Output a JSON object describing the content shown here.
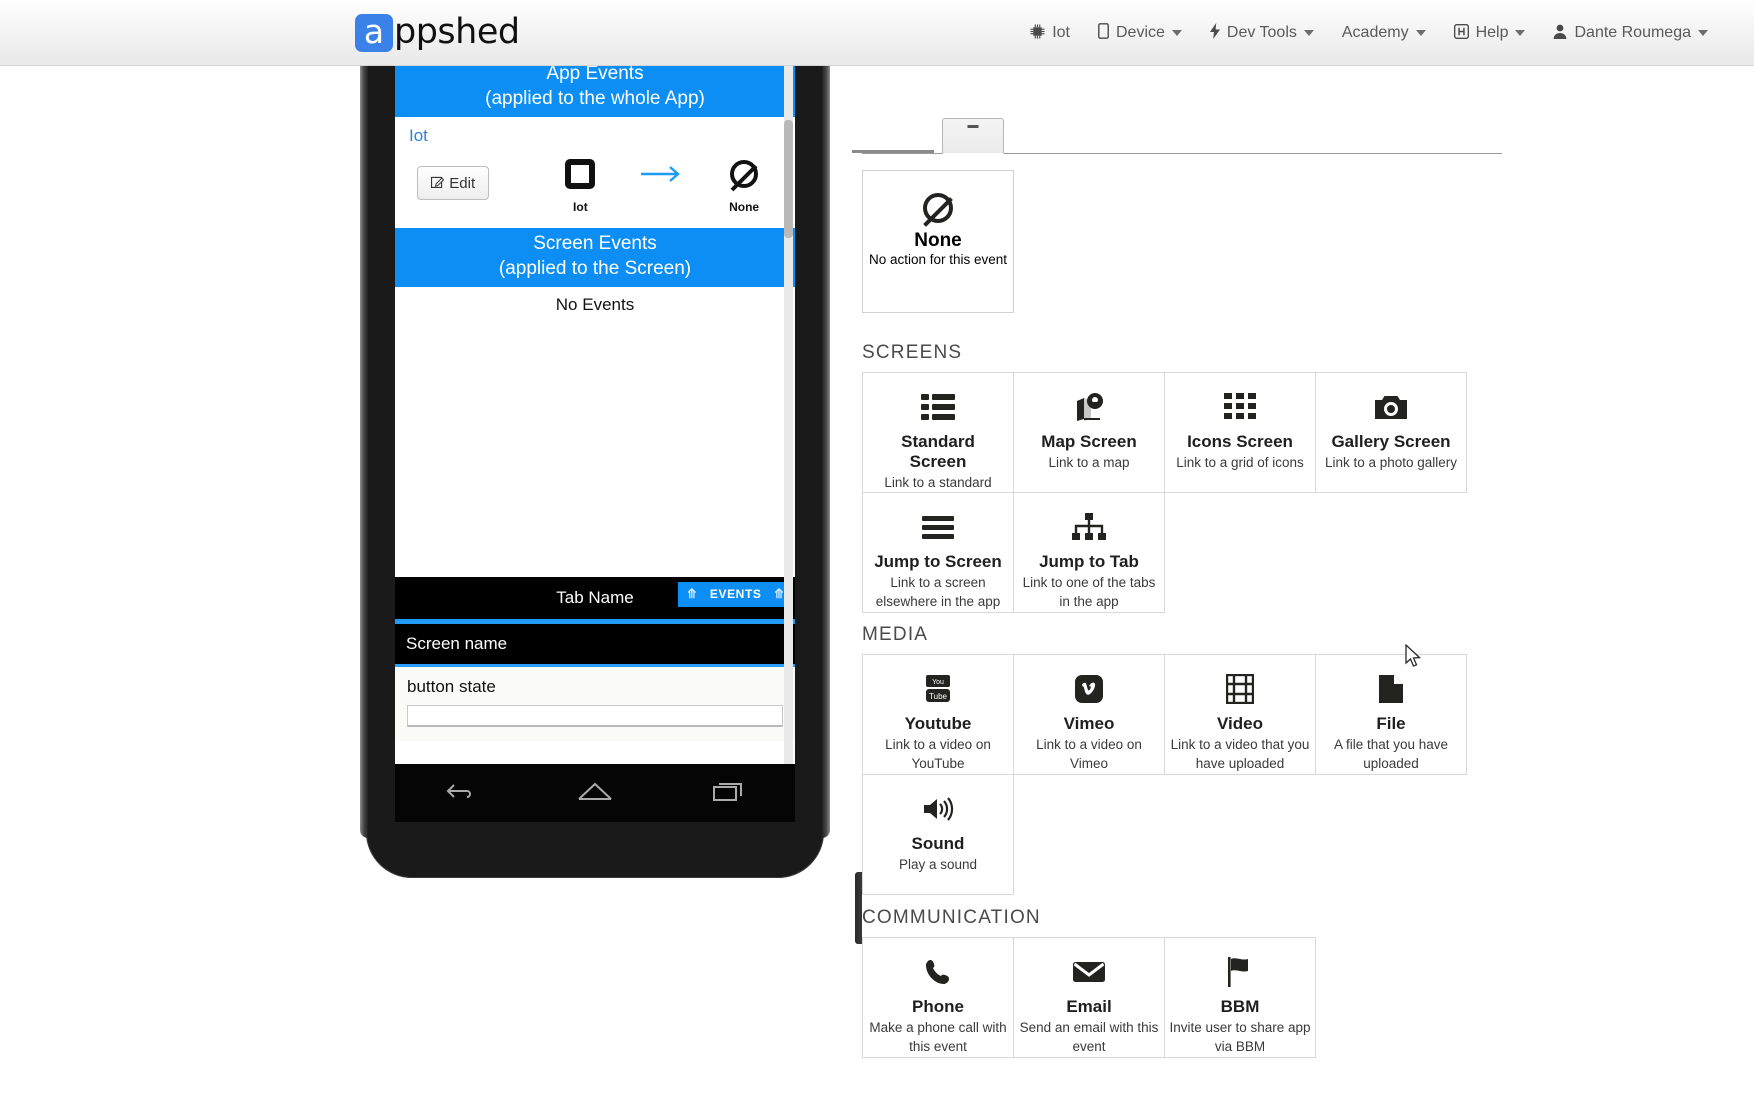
{
  "header": {
    "brand_letter": "a",
    "brand_text": "ppshed",
    "nav": [
      {
        "label": "Iot",
        "icon": "chip-icon",
        "caret": false
      },
      {
        "label": "Device",
        "icon": "mobile-icon",
        "caret": true
      },
      {
        "label": "Dev Tools",
        "icon": "bolt-icon",
        "caret": true
      },
      {
        "label": "Academy",
        "icon": "none",
        "caret": true
      },
      {
        "label": "Help",
        "icon": "help-square-icon",
        "caret": true
      },
      {
        "label": "Dante Roumega",
        "icon": "user-icon",
        "caret": true
      }
    ]
  },
  "phone": {
    "app_events": {
      "title": "App Events",
      "subtitle": "(applied to the whole App)"
    },
    "event_name": "Iot",
    "edit_button": "Edit",
    "trigger_caption": "Iot",
    "action_caption": "None",
    "screen_events": {
      "title": "Screen Events",
      "subtitle": "(applied to the Screen)"
    },
    "no_events": "No Events",
    "tab_name": "Tab Name",
    "events_button": "EVENTS",
    "screen_name": "Screen name",
    "form_label": "button state",
    "form_value": ""
  },
  "actions_panel": {
    "selected_action": {
      "title": "None",
      "desc": "No action for this event",
      "icon": "ban-icon"
    },
    "groups": [
      {
        "title": "SCREENS",
        "cards": [
          {
            "title": "Standard Screen",
            "desc": "Link to a standard",
            "icon": "list-icon"
          },
          {
            "title": "Map Screen",
            "desc": "Link to a map",
            "icon": "map-marker-icon"
          },
          {
            "title": "Icons Screen",
            "desc": "Link to a grid of icons",
            "icon": "grid-icon"
          },
          {
            "title": "Gallery Screen",
            "desc": "Link to a photo gallery",
            "icon": "camera-icon"
          },
          {
            "title": "Jump to Screen",
            "desc": "Link to a screen elsewhere in the app",
            "icon": "bars-icon"
          },
          {
            "title": "Jump to Tab",
            "desc": "Link to one of the tabs in the app",
            "icon": "sitemap-icon"
          }
        ]
      },
      {
        "title": "MEDIA",
        "cards": [
          {
            "title": "Youtube",
            "desc": "Link to a video on YouTube",
            "icon": "youtube-icon"
          },
          {
            "title": "Vimeo",
            "desc": "Link to a video on Vimeo",
            "icon": "vimeo-icon"
          },
          {
            "title": "Video",
            "desc": "Link to a video that you have uploaded",
            "icon": "film-icon"
          },
          {
            "title": "File",
            "desc": "A file that you have uploaded",
            "icon": "file-icon"
          },
          {
            "title": "Sound",
            "desc": "Play a sound",
            "icon": "volume-icon"
          }
        ]
      },
      {
        "title": "COMMUNICATION",
        "cards": [
          {
            "title": "Phone",
            "desc": "Make a phone call with this event",
            "icon": "phone-icon"
          },
          {
            "title": "Email",
            "desc": "Send an email with this event",
            "icon": "envelope-icon"
          },
          {
            "title": "BBM",
            "desc": "Invite user to share app via BBM",
            "icon": "flag-icon"
          }
        ]
      }
    ]
  },
  "colors": {
    "accent_blue": "#0d8ef5",
    "brand_blue": "#3b82e8",
    "panel_text": "#4a4a4a"
  }
}
